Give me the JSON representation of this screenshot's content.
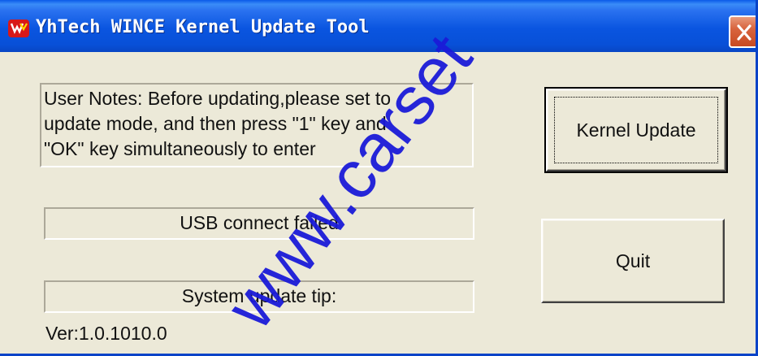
{
  "window": {
    "title": "YhTech WINCE Kernel Update Tool",
    "icons": {
      "app": "app-logo-icon",
      "close": "close-icon"
    },
    "colors": {
      "titlebar": "#0a55e0",
      "close": "#d8643e",
      "face": "#ece9d8"
    }
  },
  "notes": {
    "text": "User Notes:  Before updating,please set to\nupdate mode,  and then press \"1\" key and\n\"OK\" key simultaneously to enter"
  },
  "status": {
    "usb": "USB connect failed",
    "update_tip": "System update tip:"
  },
  "version": "Ver:1.0.1010.0",
  "buttons": {
    "kernel_update": "Kernel Update",
    "quit": "Quit"
  },
  "watermark": {
    "text": "www.carset",
    "color": "#1a1ad8"
  }
}
